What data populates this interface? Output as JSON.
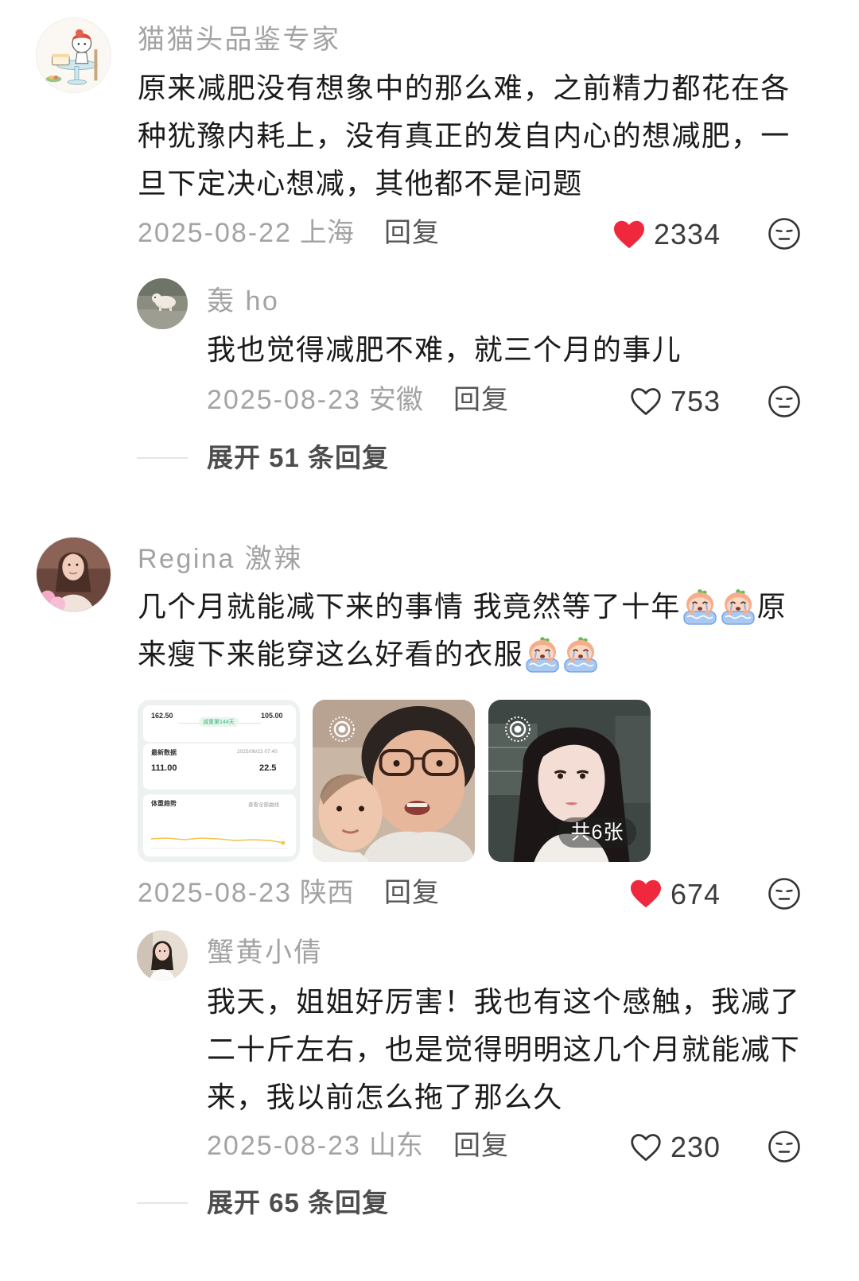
{
  "colors": {
    "background": "#ffffff",
    "text_primary": "#1b1b1b",
    "text_secondary": "#a3a3a3",
    "reply_link": "#555555",
    "like_active": "#f0283e",
    "icon_stroke": "#333333",
    "expand_text": "#4d4d4d",
    "divider": "#e5e5e5"
  },
  "thread": [
    {
      "username": "猫猫头品鉴专家",
      "text_lines": [
        "原来减肥没有想象中的那么难，之前精力都花在各",
        "种犹豫内耗上，没有真正的发自内心的想减肥，一",
        "旦下定决心想减，其他都不是问题"
      ],
      "date": "2025-08-22",
      "location": "上海",
      "reply_label": "回复",
      "likes": "2334",
      "liked": true,
      "like_icon": "heart-filled-icon",
      "dislike_icon": "dislike-face-icon",
      "reply": {
        "username": "轰 ho",
        "text_lines": [
          "我也觉得减肥不难，就三个月的事儿"
        ],
        "date": "2025-08-23",
        "location": "安徽",
        "reply_label": "回复",
        "likes": "753",
        "liked": false,
        "like_icon": "heart-outline-icon",
        "dislike_icon": "dislike-face-icon"
      },
      "expand_label": "展开 51 条回复"
    },
    {
      "username": "Regina 激辣",
      "text_lines": [
        {
          "before_emoji": "几个月就能减下来的事情 我竟然等了十年",
          "emoji": [
            "crying-emoji-icon",
            "crying-emoji-icon"
          ],
          "after_emoji": "原"
        },
        {
          "before_emoji": "来瘦下来能穿这么好看的衣服",
          "emoji": [
            "crying-emoji-icon",
            "crying-emoji-icon"
          ],
          "after_emoji": ""
        }
      ],
      "images": {
        "count_badge": "共6张",
        "live_icon": "live-photo-icon",
        "tiles": [
          {
            "live": false,
            "start_weight": "162.50",
            "goal_weight": "105.00",
            "progress_label": "减重第144天",
            "latest_title": "最新数据",
            "latest_time": "2025/08/23 07:40",
            "latest_weight": "111.00",
            "latest_bmi": "22.5",
            "trend_title": "体重趋势",
            "trend_link": "查看全部曲线"
          },
          {
            "live": true
          },
          {
            "live": true
          }
        ]
      },
      "date": "2025-08-23",
      "location": "陕西",
      "reply_label": "回复",
      "likes": "674",
      "liked": true,
      "like_icon": "heart-filled-icon",
      "dislike_icon": "dislike-face-icon",
      "reply": {
        "username": "蟹黄小倩",
        "text_lines": [
          "我天，姐姐好厉害！我也有这个感触，我减了",
          "二十斤左右，也是觉得明明这几个月就能减下",
          "来，我以前怎么拖了那么久"
        ],
        "date": "2025-08-23",
        "location": "山东",
        "reply_label": "回复",
        "likes": "230",
        "liked": false,
        "like_icon": "heart-outline-icon",
        "dislike_icon": "dislike-face-icon"
      },
      "expand_label": "展开 65 条回复"
    }
  ]
}
